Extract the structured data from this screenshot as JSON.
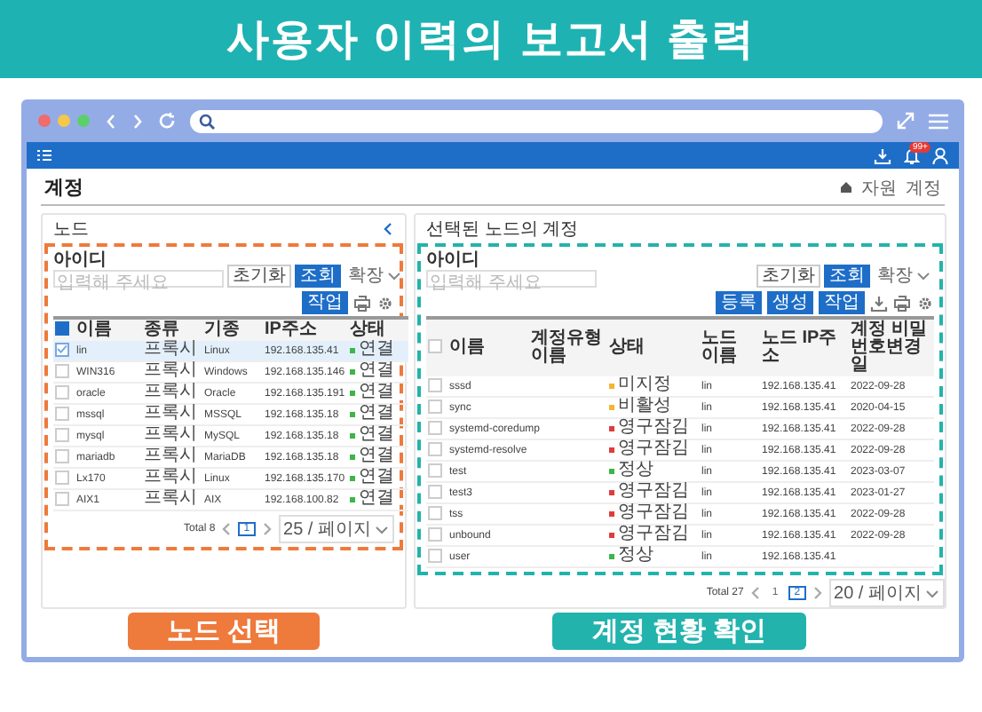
{
  "banner": {
    "title": "사용자 이력의 보고서 출력"
  },
  "app_header": {
    "notification_badge": "99+"
  },
  "page": {
    "title": "계정",
    "breadcrumb": [
      "자원",
      "계정"
    ]
  },
  "node_panel": {
    "title": "노드",
    "search_label": "아이디",
    "search_placeholder": "입력해 주세요",
    "reset_button": "초기화",
    "search_button": "조회",
    "expand": "확장",
    "toolbar_buttons": [
      "작업"
    ],
    "select_all_checked": true,
    "columns": [
      "이름",
      "종류",
      "기종",
      "IP주소",
      "상태"
    ],
    "rows": [
      {
        "selected": true,
        "name": "lin",
        "type": "프록시",
        "os": "Linux",
        "ip": "192.168.135.41",
        "status": "연결",
        "color": "#3cb54a"
      },
      {
        "selected": false,
        "name": "WIN316",
        "type": "프록시",
        "os": "Windows",
        "ip": "192.168.135.146",
        "status": "연결",
        "color": "#3cb54a"
      },
      {
        "selected": false,
        "name": "oracle",
        "type": "프록시",
        "os": "Oracle",
        "ip": "192.168.135.191",
        "status": "연결",
        "color": "#3cb54a"
      },
      {
        "selected": false,
        "name": "mssql",
        "type": "프록시",
        "os": "MSSQL",
        "ip": "192.168.135.18",
        "status": "연결",
        "color": "#3cb54a"
      },
      {
        "selected": false,
        "name": "mysql",
        "type": "프록시",
        "os": "MySQL",
        "ip": "192.168.135.18",
        "status": "연결",
        "color": "#3cb54a"
      },
      {
        "selected": false,
        "name": "mariadb",
        "type": "프록시",
        "os": "MariaDB",
        "ip": "192.168.135.18",
        "status": "연결",
        "color": "#3cb54a"
      },
      {
        "selected": false,
        "name": "Lx170",
        "type": "프록시",
        "os": "Linux",
        "ip": "192.168.135.170",
        "status": "연결",
        "color": "#3cb54a"
      },
      {
        "selected": false,
        "name": "AIX1",
        "type": "프록시",
        "os": "AIX",
        "ip": "192.168.100.82",
        "status": "연결",
        "color": "#3cb54a"
      }
    ],
    "pagination": {
      "total": "Total 8",
      "pages": [
        {
          "label": "1",
          "selected": true
        }
      ],
      "per_page": "25 / 페이지"
    }
  },
  "account_panel": {
    "title": "선택된 노드의 계정",
    "search_label": "아이디",
    "search_placeholder": "입력해 주세요",
    "reset_button": "초기화",
    "search_button": "조회",
    "expand": "확장",
    "toolbar_buttons": [
      "등록",
      "생성",
      "작업"
    ],
    "select_all_checked": false,
    "columns": [
      "이름",
      "계정유형 이름",
      "상태",
      "노드 이름",
      "노드 IP주소",
      "계정 비밀번호변경일"
    ],
    "rows": [
      {
        "selected": false,
        "name": "sssd",
        "status": "미지정",
        "color": "#f2b632",
        "node": "lin",
        "ip": "192.168.135.41",
        "changed": "2022-09-28"
      },
      {
        "selected": false,
        "name": "sync",
        "status": "비활성",
        "color": "#f2b632",
        "node": "lin",
        "ip": "192.168.135.41",
        "changed": "2020-04-15"
      },
      {
        "selected": false,
        "name": "systemd-coredump",
        "status": "영구잠김",
        "color": "#e03c3c",
        "node": "lin",
        "ip": "192.168.135.41",
        "changed": "2022-09-28"
      },
      {
        "selected": false,
        "name": "systemd-resolve",
        "status": "영구잠김",
        "color": "#e03c3c",
        "node": "lin",
        "ip": "192.168.135.41",
        "changed": "2022-09-28"
      },
      {
        "selected": false,
        "name": "test",
        "status": "정상",
        "color": "#3cb54a",
        "node": "lin",
        "ip": "192.168.135.41",
        "changed": "2023-03-07"
      },
      {
        "selected": false,
        "name": "test3",
        "status": "영구잠김",
        "color": "#e03c3c",
        "node": "lin",
        "ip": "192.168.135.41",
        "changed": "2023-01-27"
      },
      {
        "selected": false,
        "name": "tss",
        "status": "영구잠김",
        "color": "#e03c3c",
        "node": "lin",
        "ip": "192.168.135.41",
        "changed": "2022-09-28"
      },
      {
        "selected": false,
        "name": "unbound",
        "status": "영구잠김",
        "color": "#e03c3c",
        "node": "lin",
        "ip": "192.168.135.41",
        "changed": "2022-09-28"
      },
      {
        "selected": false,
        "name": "user",
        "status": "정상",
        "color": "#3cb54a",
        "node": "lin",
        "ip": "192.168.135.41"
      }
    ],
    "pagination": {
      "total": "Total 27",
      "pages": [
        {
          "label": "1",
          "selected": false
        },
        {
          "label": "2",
          "selected": true
        }
      ],
      "per_page": "20 / 페이지"
    }
  },
  "callouts": [
    {
      "label": "노드 선택",
      "color": "#ee7a3c"
    },
    {
      "label": "계정 현황 확인",
      "color": "#22b3ad"
    }
  ]
}
